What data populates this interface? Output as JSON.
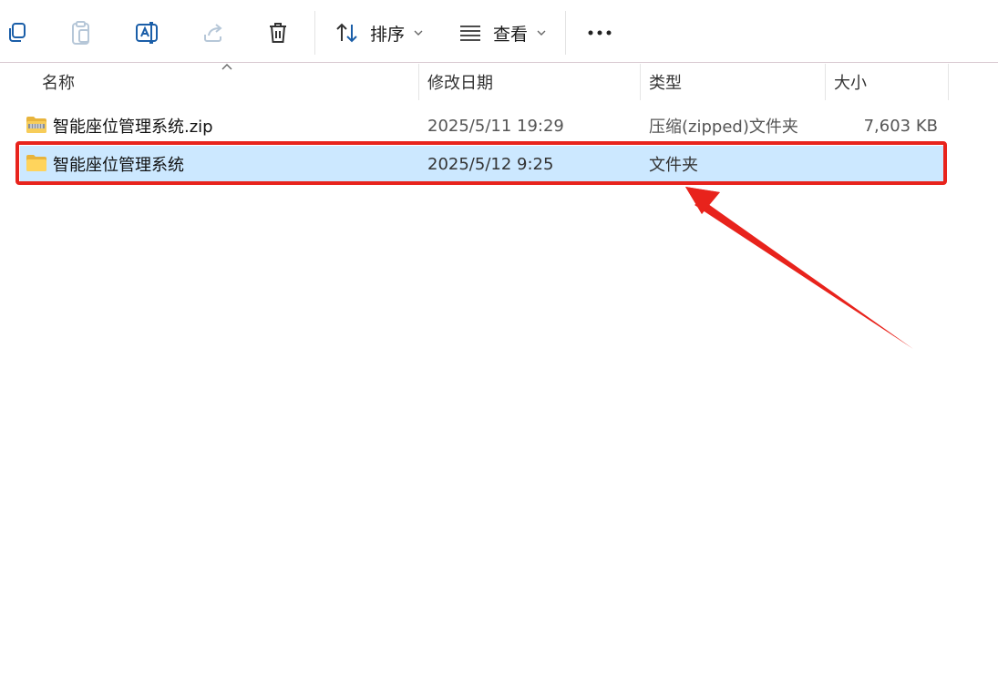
{
  "toolbar": {
    "sort_label": "排序",
    "view_label": "查看"
  },
  "columns": {
    "name": "名称",
    "modified": "修改日期",
    "type": "类型",
    "size": "大小"
  },
  "files": [
    {
      "name": "智能座位管理系统.zip",
      "modified": "2025/5/11 19:29",
      "type": "压缩(zipped)文件夹",
      "size": "7,603 KB",
      "icon": "zip-folder-icon"
    },
    {
      "name": "智能座位管理系统",
      "modified": "2025/5/12 9:25",
      "type": "文件夹",
      "size": "",
      "icon": "folder-icon",
      "selected": true
    }
  ],
  "colors": {
    "selection": "#cce8ff",
    "annotation": "#e8231c",
    "accent": "#0067c0"
  }
}
